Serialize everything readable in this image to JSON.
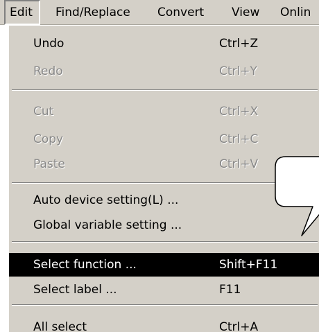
{
  "menubar": {
    "items": [
      {
        "label": "Edit"
      },
      {
        "label": "Find/Replace"
      },
      {
        "label": "Convert"
      },
      {
        "label": "View"
      },
      {
        "label": "Onlin"
      }
    ],
    "active": "Edit"
  },
  "edit_menu": {
    "groups": [
      [
        {
          "label": "Undo",
          "shortcut": "Ctrl+Z",
          "enabled": true
        },
        {
          "label": "Redo",
          "shortcut": "Ctrl+Y",
          "enabled": false
        }
      ],
      [
        {
          "label": "Cut",
          "shortcut": "Ctrl+X",
          "enabled": false
        },
        {
          "label": "Copy",
          "shortcut": "Ctrl+C",
          "enabled": false
        },
        {
          "label": "Paste",
          "shortcut": "Ctrl+V",
          "enabled": false
        }
      ],
      [
        {
          "label": "Auto device setting(L) ...",
          "shortcut": "",
          "enabled": true
        },
        {
          "label": "Global variable setting ...",
          "shortcut": "",
          "enabled": true
        }
      ],
      [
        {
          "label": "Select function ...",
          "shortcut": "Shift+F11",
          "enabled": true,
          "highlighted": true
        },
        {
          "label": "Select label ...",
          "shortcut": "F11",
          "enabled": true
        }
      ],
      [
        {
          "label": "All select",
          "shortcut": "Ctrl+A",
          "enabled": true
        }
      ]
    ]
  },
  "callout": {
    "text": "",
    "fill": "#ffffff",
    "stroke": "#000000"
  },
  "colors": {
    "menu_background": "#d4d0c8",
    "highlight_background": "#000000",
    "highlight_text": "#ffffff",
    "disabled_text": "#888888"
  }
}
